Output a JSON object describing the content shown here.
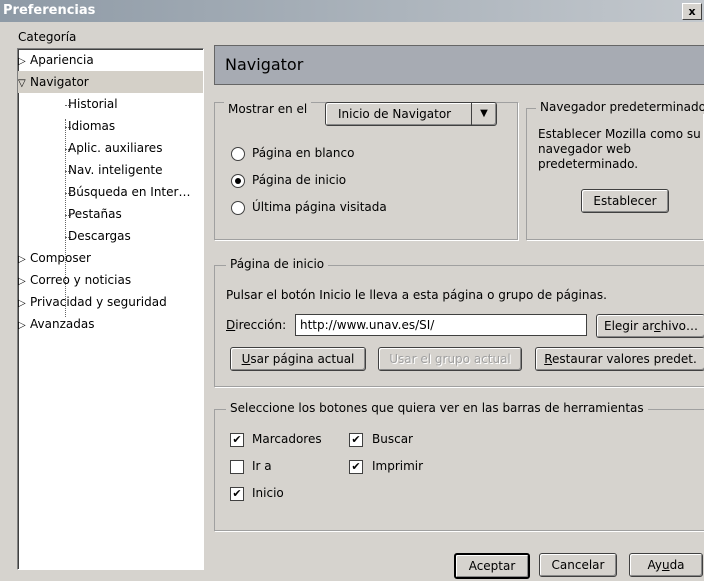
{
  "window": {
    "title": "Preferencias",
    "close_glyph": "x"
  },
  "sidebar": {
    "label": "Categoría",
    "items": [
      {
        "label": "Apariencia",
        "expander": "▷"
      },
      {
        "label": "Navigator",
        "expander": "▽"
      },
      {
        "label": "Historial"
      },
      {
        "label": "Idiomas"
      },
      {
        "label": "Aplic. auxiliares"
      },
      {
        "label": "Nav. inteligente"
      },
      {
        "label": "Búsqueda en Inter…"
      },
      {
        "label": "Pestañas"
      },
      {
        "label": "Descargas"
      },
      {
        "label": "Composer",
        "expander": "▷"
      },
      {
        "label": "Correo y noticias",
        "expander": "▷"
      },
      {
        "label": "Privacidad y seguridad",
        "expander": "▷"
      },
      {
        "label": "Avanzadas",
        "expander": "▷"
      }
    ]
  },
  "panel": {
    "title": "Navigator",
    "show_group": {
      "label": "Mostrar en el",
      "dropdown_value": "Inicio de Navigator",
      "options": [
        {
          "label": "Página en blanco",
          "checked": false
        },
        {
          "label": "Página de inicio",
          "checked": true
        },
        {
          "label": "Última página visitada",
          "checked": false
        }
      ]
    },
    "default_browser": {
      "legend": "Navegador predeterminado",
      "text1": "Establecer Mozilla como su",
      "text2": "navegador web",
      "text3": "predeterminado.",
      "button": "Establecer"
    },
    "homepage": {
      "legend": "Página de inicio",
      "description": "Pulsar el botón Inicio le lleva a esta página o grupo de páginas.",
      "address_label_first": "D",
      "address_label_rest": "irección:",
      "address_value": "http://www.unav.es/SI/",
      "choose_file_pre": "Elegir ar",
      "choose_file_u": "c",
      "choose_file_post": "hivo…",
      "use_current_u": "U",
      "use_current_rest": "sar página actual",
      "use_group": "Usar el grupo actual",
      "restore_u": "R",
      "restore_rest": "estaurar valores predet."
    },
    "toolbar_buttons": {
      "legend": "Seleccione los botones que quiera ver en las barras de herramientas",
      "items": [
        {
          "label": "Marcadores",
          "checked": true
        },
        {
          "label": "Buscar",
          "checked": true
        },
        {
          "label": "Ir a",
          "checked": false
        },
        {
          "label": "Imprimir",
          "checked": true
        },
        {
          "label": "Inicio",
          "checked": true
        }
      ]
    }
  },
  "footer": {
    "ok": "Aceptar",
    "cancel": "Cancelar",
    "help_pre": "Ay",
    "help_u": "u",
    "help_post": "da"
  }
}
